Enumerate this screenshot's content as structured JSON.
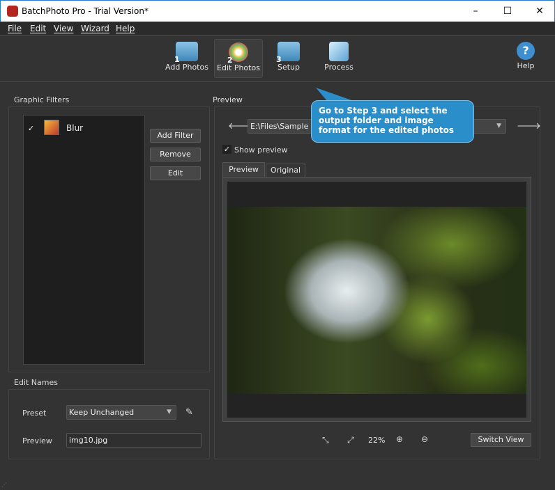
{
  "window": {
    "title": "BatchPhoto Pro - Trial Version*",
    "minimize": "–",
    "maximize": "☐",
    "close": "✕"
  },
  "menu": [
    "File",
    "Edit",
    "View",
    "Wizard",
    "Help"
  ],
  "toolbar": {
    "steps": [
      {
        "num": "1",
        "label": "Add Photos"
      },
      {
        "num": "2",
        "label": "Edit Photos",
        "active": true
      },
      {
        "num": "3",
        "label": "Setup"
      },
      {
        "num": "",
        "label": "Process"
      }
    ],
    "help": "Help",
    "help_icon": "?"
  },
  "filters": {
    "title": "Graphic Filters",
    "items": [
      {
        "checked": true,
        "label": "Blur"
      }
    ],
    "add": "Add Filter",
    "remove": "Remove",
    "edit": "Edit"
  },
  "edit_names": {
    "title": "Edit Names",
    "preset_label": "Preset",
    "preset_value": "Keep Unchanged",
    "preview_label": "Preview",
    "preview_value": "img10.jpg"
  },
  "preview": {
    "title": "Preview",
    "path": "E:\\Files\\Sample Images\\Landscapes\\img10.jpg",
    "show_preview": "Show preview",
    "show_preview_checked": true,
    "tabs": [
      "Preview",
      "Original"
    ],
    "zoom": "22%",
    "switch_view": "Switch View"
  },
  "tooltip": "Go to Step 3 and select the output folder and image format for the edited photos"
}
